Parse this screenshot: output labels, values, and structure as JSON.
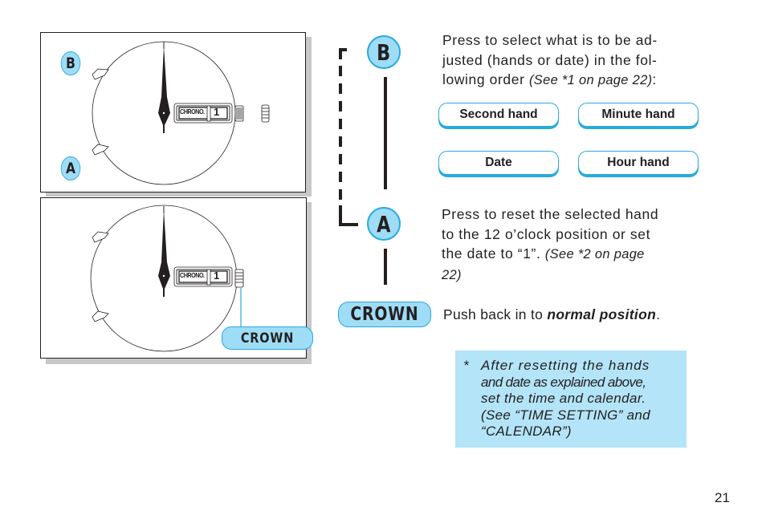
{
  "figures": {
    "top": {
      "button_b_label": "B",
      "button_a_label": "A",
      "date_window": {
        "chrono_label": "CHRONO.",
        "date_value": "1"
      },
      "crown_state": "pulled-out"
    },
    "bottom": {
      "date_window": {
        "chrono_label": "CHRONO.",
        "date_value": "1"
      },
      "crown_label": "CROWN",
      "crown_state": "pushed-in"
    }
  },
  "flow": {
    "b_label": "B",
    "a_label": "A",
    "crown_label": "CROWN"
  },
  "steps": {
    "b": {
      "text": "Press to select what is to be ad-justed (hands or date) in the fol-lowing order",
      "line1": "Press to select what is to be ad-",
      "line2": "justed (hands or date) in the fol-",
      "line3": "lowing order ",
      "ref": "(See *1 on page 22)",
      "tail": ":"
    },
    "order_buttons": [
      {
        "label": "Second hand"
      },
      {
        "label": "Minute hand"
      },
      {
        "label": "Date"
      },
      {
        "label": "Hour hand"
      }
    ],
    "a": {
      "line1": "Press to reset the selected hand",
      "line2": "to the 12 o’clock position or set",
      "line3": "the date to “1”. ",
      "ref1": "(See *2 on page",
      "ref2": "22)"
    },
    "crown": {
      "text": "Push back in to ",
      "emphasis": "normal position",
      "tail": "."
    }
  },
  "note": {
    "star": "*",
    "line1": "After resetting the hands",
    "line2": "and date as explained above,",
    "line3": "set the time and calendar.",
    "line4": "(See “TIME SETTING” and",
    "line5": "“CALENDAR”)"
  },
  "colors": {
    "accent_light": "#9fdcf5",
    "accent_border": "#29a9e0",
    "note_bg": "#b3e4f7",
    "ink": "#231f20"
  },
  "page_number": "21"
}
